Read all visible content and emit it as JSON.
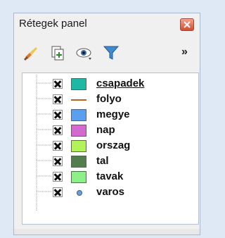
{
  "panel": {
    "title": "Rétegek panel",
    "close_icon": "close-icon",
    "overflow_label": "»"
  },
  "toolbar": {
    "buttons": [
      {
        "name": "style-brush-icon"
      },
      {
        "name": "add-group-icon"
      },
      {
        "name": "visibility-eye-icon"
      },
      {
        "name": "filter-funnel-icon"
      }
    ]
  },
  "layers": [
    {
      "name": "csapadek",
      "checked": true,
      "symbol": "fill",
      "color": "#1fb7a6",
      "selected": true
    },
    {
      "name": "folyo",
      "checked": true,
      "symbol": "line",
      "color": "#b5651d",
      "selected": false
    },
    {
      "name": "megye",
      "checked": true,
      "symbol": "fill",
      "color": "#5c9ff0",
      "selected": false
    },
    {
      "name": "nap",
      "checked": true,
      "symbol": "fill",
      "color": "#d36ad0",
      "selected": false
    },
    {
      "name": "orszag",
      "checked": true,
      "symbol": "fill",
      "color": "#b4f25b",
      "selected": false
    },
    {
      "name": "tal",
      "checked": true,
      "symbol": "fill",
      "color": "#537d4c",
      "selected": false
    },
    {
      "name": "tavak",
      "checked": true,
      "symbol": "fill",
      "color": "#8ef089",
      "selected": false
    },
    {
      "name": "varos",
      "checked": true,
      "symbol": "point",
      "color": "#6aa0d9",
      "selected": false
    }
  ]
}
